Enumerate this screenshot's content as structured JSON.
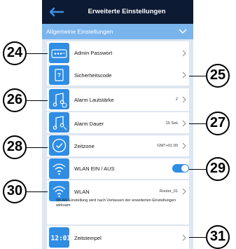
{
  "header": {
    "title": "Erweiterte Einstellungen"
  },
  "section": {
    "label": "Allgemeine Einstellungen"
  },
  "rows": [
    {
      "label": "Admin Passwort",
      "value": ""
    },
    {
      "label": "Sicherheitscode",
      "value": ""
    },
    {
      "label": "Alarm Lautstärke",
      "value": "2"
    },
    {
      "label": "Alarm Dauer",
      "value": "15 Sek"
    },
    {
      "label": "Zeitzone",
      "value": "GMT+01:00"
    },
    {
      "label": "WLAN EIN / AUS",
      "value": ""
    },
    {
      "label": "WLAN",
      "value": "Router_01"
    },
    {
      "label": "Zeitstempel",
      "value": ""
    }
  ],
  "wifi_toggle": {
    "on": true
  },
  "wifi_note": "WLAN-Einstellung wird nach Verlassen der erweiterten Einstellungen wirksam",
  "callouts": [
    "24",
    "25",
    "26",
    "27",
    "28",
    "29",
    "30",
    "31"
  ],
  "colors": {
    "header_bg": "#0d1a33",
    "section_bg": "#7ab4ec",
    "accent": "#2f8de4",
    "page_bg": "#dde6f1"
  }
}
